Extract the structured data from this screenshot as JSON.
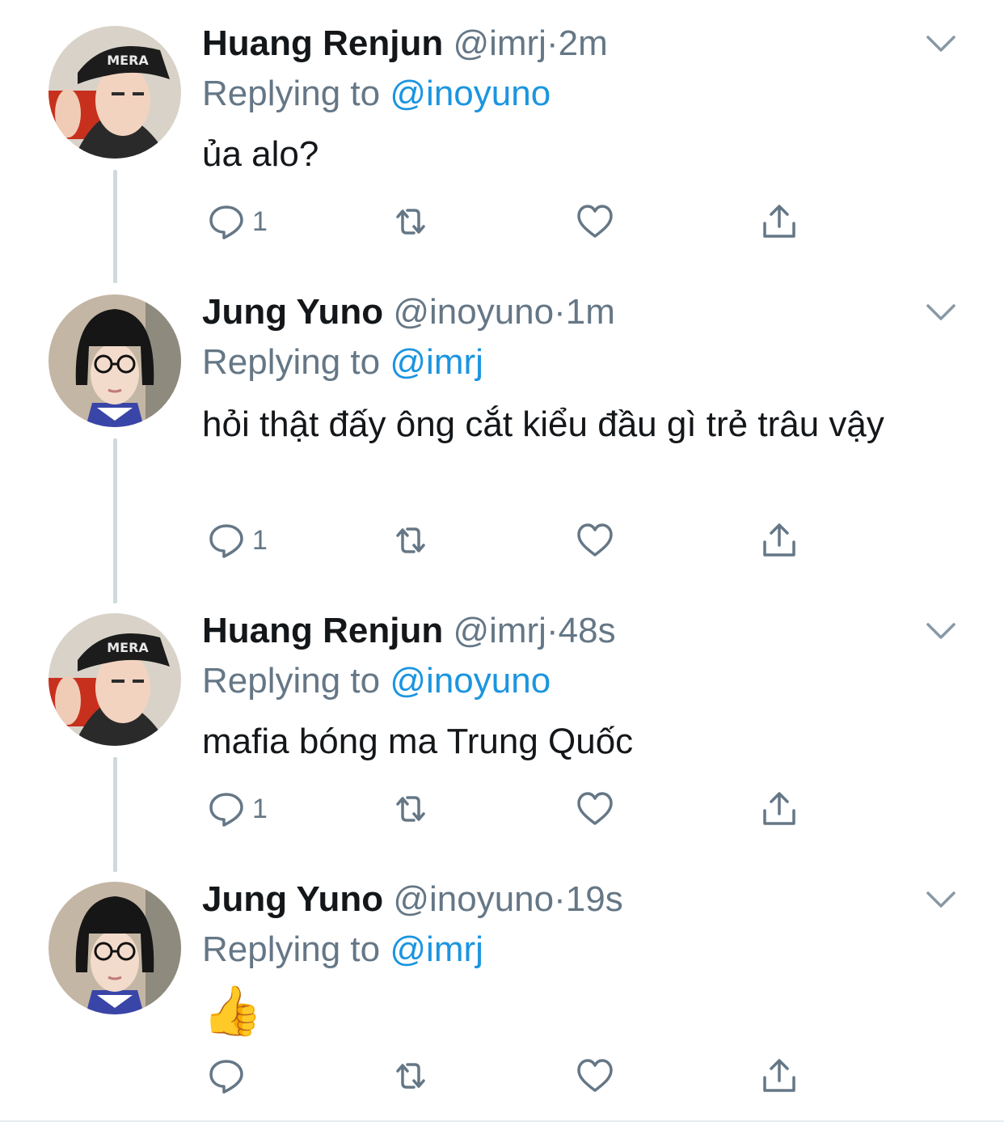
{
  "colors": {
    "name": "#14171a",
    "meta": "#657786",
    "mention": "#1b95e0",
    "thread_line": "#cfd9de"
  },
  "icons": {
    "reply": "reply-icon",
    "retweet": "retweet-icon",
    "like": "heart-icon",
    "share": "share-icon",
    "menu": "chevron-down-icon"
  },
  "tweets": [
    {
      "name": "Huang Renjun",
      "handle": "@imrj",
      "dot": "·",
      "time": "2m",
      "replying_to_label": "Replying to",
      "replying_to": "@inoyuno",
      "text": "ủa alo?",
      "reply_count": "1"
    },
    {
      "name": "Jung Yuno",
      "handle": "@inoyuno",
      "dot": "·",
      "time": "1m",
      "replying_to_label": "Replying to",
      "replying_to": "@imrj",
      "text": "hỏi thật đấy ông cắt kiểu đầu gì trẻ trâu vậy",
      "reply_count": "1"
    },
    {
      "name": "Huang Renjun",
      "handle": "@imrj",
      "dot": "·",
      "time": "48s",
      "replying_to_label": "Replying to",
      "replying_to": "@inoyuno",
      "text": "mafia bóng ma Trung Quốc",
      "reply_count": "1"
    },
    {
      "name": "Jung Yuno",
      "handle": "@inoyuno",
      "dot": "·",
      "time": "19s",
      "replying_to_label": "Replying to",
      "replying_to": "@imrj",
      "text": "👍",
      "reply_count": ""
    }
  ]
}
